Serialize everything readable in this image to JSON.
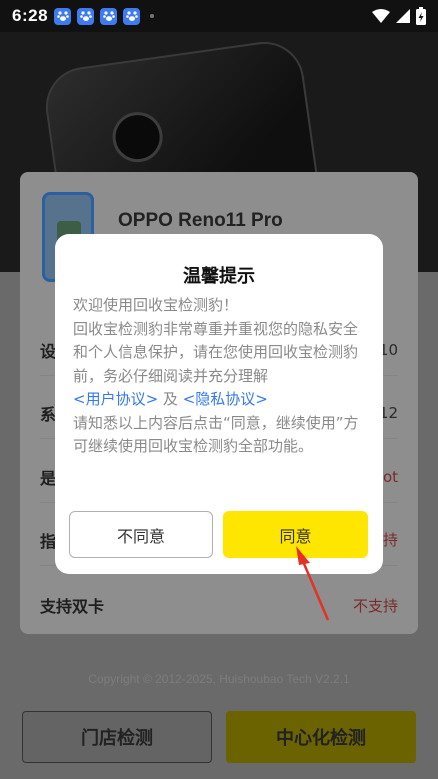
{
  "status_bar": {
    "time": "6:28",
    "notification_icons": [
      "baidu-paw-icon",
      "baidu-paw-icon",
      "baidu-paw-icon",
      "baidu-paw-icon"
    ],
    "right_icons": [
      "wifi-icon",
      "cellular-signal-icon",
      "battery-charging-icon"
    ]
  },
  "device": {
    "name": "OPPO Reno11 Pro"
  },
  "specs": [
    {
      "key": "设",
      "value": "10"
    },
    {
      "key": "系",
      "value": "12"
    },
    {
      "key": "是",
      "value": "ot"
    },
    {
      "key": "指",
      "value": "持"
    },
    {
      "key": "支持双卡",
      "value": "不支持"
    }
  ],
  "footer": {
    "copyright": "Copyright © 2012-2025, Huishoubao Tech V2.2.1"
  },
  "bottom_buttons": {
    "store_label": "门店检测",
    "center_label": "中心化检测"
  },
  "dialog": {
    "title": "温馨提示",
    "line1": "欢迎使用回收宝检测豹！",
    "line2": "回收宝检测豹非常尊重并重视您的隐私安全和个人信息保护，请在您使用回收宝检测豹前，务必仔细阅读并充分理解",
    "user_agreement": "<用户协议>",
    "and": "及",
    "privacy_agreement": "<隐私协议>",
    "line3": "请知悉以上内容后点击“同意，继续使用”方可继续使用回收宝检测豹全部功能。",
    "disagree_label": "不同意",
    "agree_label": "同意"
  },
  "colors": {
    "accent_yellow": "#ffe600",
    "link_blue": "#3478f6",
    "warning_red": "#cc2222"
  }
}
